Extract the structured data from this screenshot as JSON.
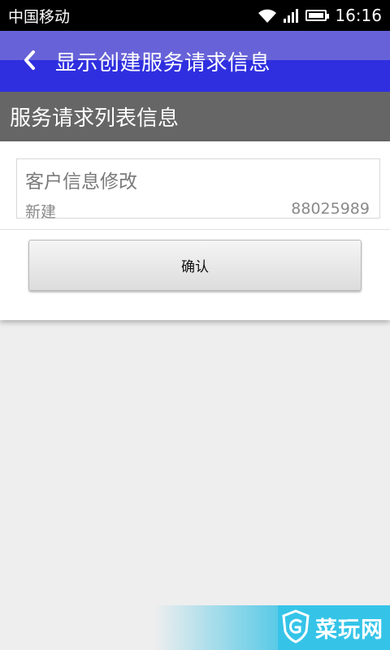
{
  "status_bar": {
    "carrier": "中国移动",
    "time": "16:16",
    "icons": [
      "wifi-icon",
      "signal-icon",
      "battery-icon"
    ]
  },
  "app_bar": {
    "back_icon": "chevron-left-icon",
    "title": "显示创建服务请求信息",
    "colors": {
      "top": "#6762d8",
      "bottom": "#2f2fe0"
    }
  },
  "section": {
    "title": "服务请求列表信息"
  },
  "request_list": [
    {
      "title": "客户信息修改",
      "status": "新建",
      "number": "88025989"
    }
  ],
  "actions": {
    "confirm_label": "确认"
  },
  "watermark": {
    "logo_icon": "caiwan-shield-icon",
    "text": "菜玩网"
  }
}
